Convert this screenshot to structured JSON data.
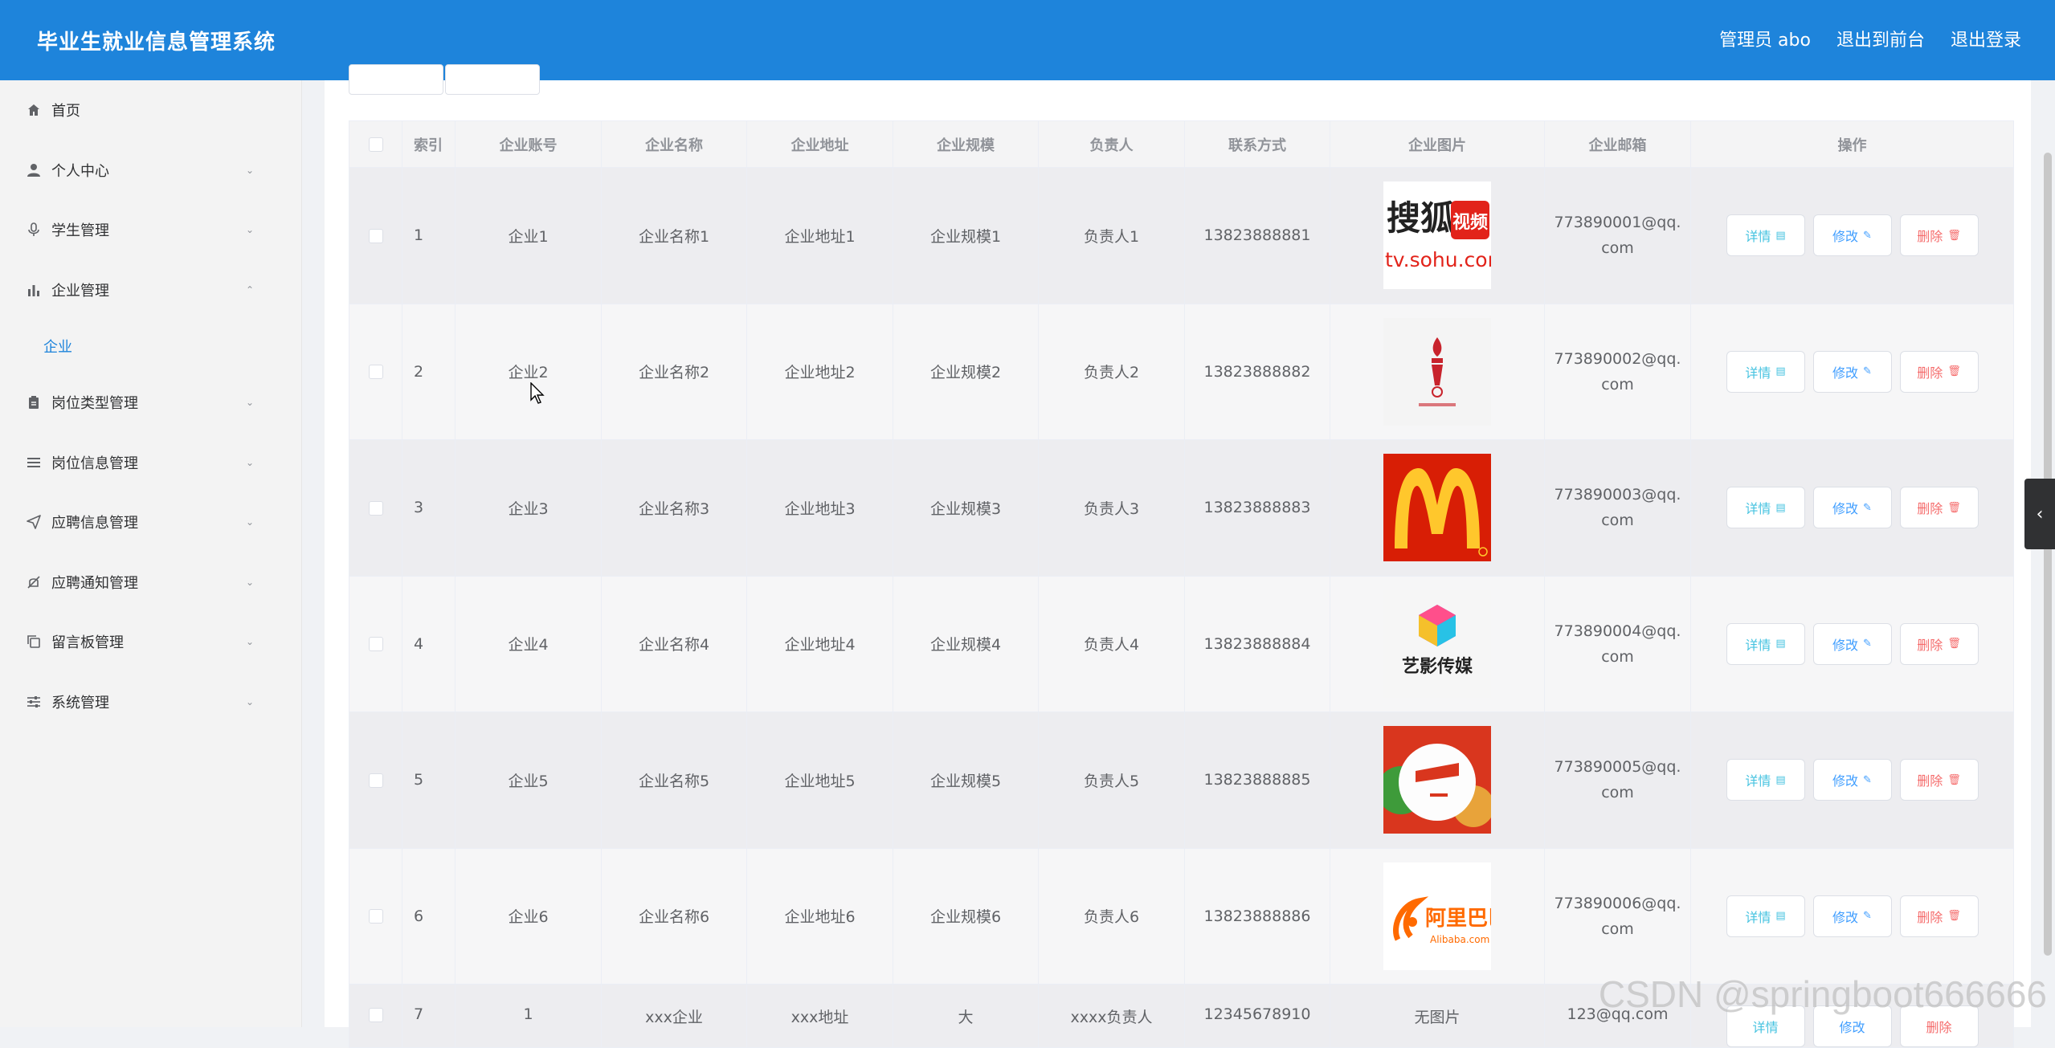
{
  "header": {
    "title": "毕业生就业信息管理系统",
    "admin_label": "管理员 abo",
    "to_front": "退出到前台",
    "logout": "退出登录",
    "bg_color": "#1e84db"
  },
  "sidebar": {
    "items": [
      {
        "label": "首页",
        "icon": "home-icon"
      },
      {
        "label": "个人中心",
        "icon": "user-icon"
      },
      {
        "label": "学生管理",
        "icon": "microphone-icon"
      },
      {
        "label": "企业管理",
        "icon": "bar-chart-icon",
        "expanded": true
      },
      {
        "label": "岗位类型管理",
        "icon": "clipboard-icon"
      },
      {
        "label": "岗位信息管理",
        "icon": "list-icon"
      },
      {
        "label": "应聘信息管理",
        "icon": "send-icon"
      },
      {
        "label": "应聘通知管理",
        "icon": "bell-off-icon"
      },
      {
        "label": "留言板管理",
        "icon": "copy-icon"
      },
      {
        "label": "系统管理",
        "icon": "sliders-icon"
      }
    ],
    "subitem": "企业"
  },
  "table": {
    "headers": [
      "索引",
      "企业账号",
      "企业名称",
      "企业地址",
      "企业规模",
      "负责人",
      "联系方式",
      "企业图片",
      "企业邮箱",
      "操作"
    ],
    "buttons": {
      "detail": "详情",
      "edit": "修改",
      "delete": "删除"
    },
    "rows": [
      {
        "index": "1",
        "account": "企业1",
        "name": "企业名称1",
        "address": "企业地址1",
        "scale": "企业规模1",
        "person": "负责人1",
        "phone": "13823888881",
        "image": "sohu-logo",
        "email": "773890001@qq.com"
      },
      {
        "index": "2",
        "account": "企业2",
        "name": "企业名称2",
        "address": "企业地址2",
        "scale": "企业规模2",
        "person": "负责人2",
        "phone": "13823888882",
        "image": "torch-logo",
        "email": "773890002@qq.com"
      },
      {
        "index": "3",
        "account": "企业3",
        "name": "企业名称3",
        "address": "企业地址3",
        "scale": "企业规模3",
        "person": "负责人3",
        "phone": "13823888883",
        "image": "mcdonalds-logo",
        "email": "773890003@qq.com"
      },
      {
        "index": "4",
        "account": "企业4",
        "name": "企业名称4",
        "address": "企业地址4",
        "scale": "企业规模4",
        "person": "负责人4",
        "phone": "13823888884",
        "image": "yiying-logo",
        "email": "773890004@qq.com"
      },
      {
        "index": "5",
        "account": "企业5",
        "name": "企业名称5",
        "address": "企业地址5",
        "scale": "企业规模5",
        "person": "负责人5",
        "phone": "13823888885",
        "image": "pizza-logo",
        "email": "773890005@qq.com"
      },
      {
        "index": "6",
        "account": "企业6",
        "name": "企业名称6",
        "address": "企业地址6",
        "scale": "企业规模6",
        "person": "负责人6",
        "phone": "13823888886",
        "image": "alibaba-logo",
        "email": "773890006@qq.com"
      }
    ],
    "partial_row": {
      "index": "7",
      "account": "1",
      "name": "xxx企业",
      "address": "xxx地址",
      "scale": "大",
      "person": "xxxx负责人",
      "phone": "12345678910",
      "image_text": "无图片",
      "email": "123@qq.com"
    }
  },
  "logo_text": {
    "sohu_top": "搜狐",
    "sohu_box": "视频",
    "sohu_url": "tv.sohu.com",
    "yiying": "艺影传媒",
    "alibaba": "阿里巴巴",
    "alibaba_small": "Alibaba.com"
  },
  "watermark": "CSDN @springboot666666"
}
